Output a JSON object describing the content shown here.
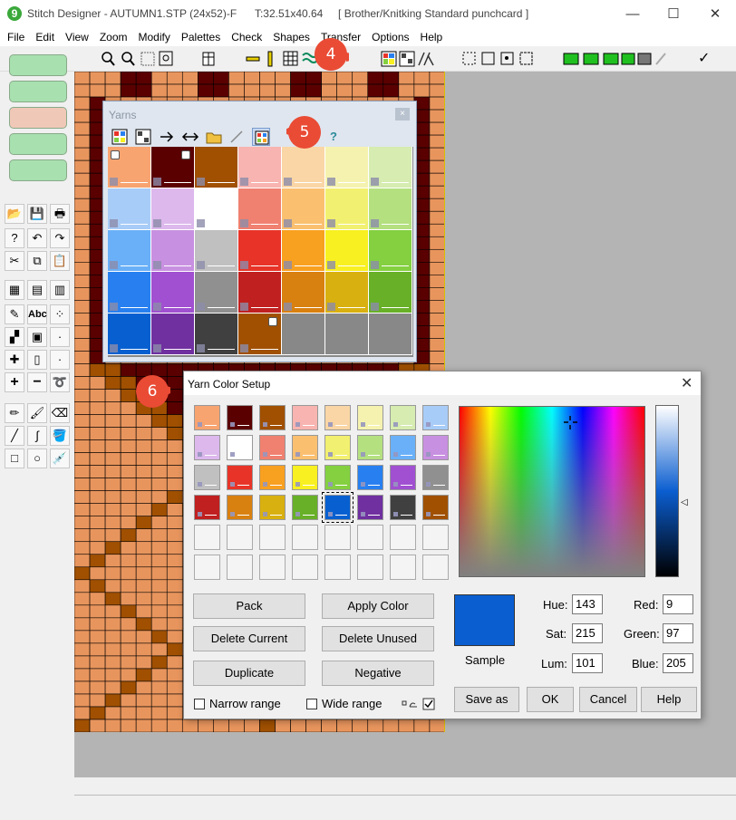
{
  "window": {
    "title": "Stitch Designer - AUTUMN1.STP (24x52)-F      T:32.51x40.64     [ Brother/Knitking Standard punchcard ]",
    "app_icon_glyph": "9",
    "minimize_glyph": "—",
    "maximize_glyph": "☐",
    "close_glyph": "✕"
  },
  "menu": [
    "File",
    "Edit",
    "View",
    "Zoom",
    "Modify",
    "Palettes",
    "Check",
    "Shapes",
    "Transfer",
    "Options",
    "Help"
  ],
  "toolbar": {
    "zoom_icons": [
      "zoom-in-icon",
      "zoom-out-icon",
      "zoom-fit-icon",
      "zoom-window-icon"
    ],
    "right_check_glyph": "✓"
  },
  "tool_panel": {
    "big_buttons": [
      "sweater-icon",
      "chart-icon",
      "stitch-pattern-icon",
      "knitting-machine-icon",
      "image-icon"
    ],
    "abc_label": "Abc",
    "plus_label": "+",
    "minus_label": "−"
  },
  "canvas": {
    "background_color": "#e8955d",
    "dark_color": "#5a0000",
    "brown_color": "#a05000"
  },
  "yarns_palette": {
    "title": "Yarns",
    "close_glyph": "×",
    "help_glyph": "?",
    "rows": [
      [
        "#f8a471",
        "#5a0000",
        "#a05000",
        "#f8b4b0",
        "#fad6a6",
        "#f5f2b0",
        "#d6ecb0"
      ],
      [
        "#a8ccf8",
        "#dcb8ec",
        "#ffffff",
        "#f08070",
        "#fac070",
        "#f2f070",
        "#b4e080"
      ],
      [
        "#6ab0f8",
        "#c890e0",
        "#c0c0c0",
        "#e83428",
        "#f8a020",
        "#f8f020",
        "#84d040"
      ],
      [
        "#2880f0",
        "#a050d0",
        "#909090",
        "#c02020",
        "#d88010",
        "#d8b010",
        "#68b028"
      ],
      [
        "#0860d0",
        "#7030a0",
        "#404040",
        "#a05000",
        "#888888",
        "#888888",
        "#888888"
      ]
    ]
  },
  "dialog": {
    "title": "Yarn Color Setup",
    "close_glyph": "✕",
    "swatches": [
      [
        "#f8a471",
        "#5a0000",
        "#a05000",
        "#f8b4b0",
        "#fad6a6",
        "#f5f2b0",
        "#d6ecb0",
        "#a8ccf8"
      ],
      [
        "#dcb8ec",
        "#ffffff",
        "#f08070",
        "#fac070",
        "#f2f070",
        "#b4e080",
        "#6ab0f8",
        "#c890e0"
      ],
      [
        "#c0c0c0",
        "#e83428",
        "#f8a020",
        "#f8f020",
        "#84d040",
        "#2880f0",
        "#a050d0",
        "#909090"
      ],
      [
        "#c02020",
        "#d88010",
        "#d8b010",
        "#68b028",
        "#0860d0",
        "#7030a0",
        "#404040",
        "#a05000"
      ],
      [
        "",
        "",
        "",
        "",
        "",
        "",
        "",
        ""
      ],
      [
        "",
        "",
        "",
        "",
        "",
        "",
        "",
        ""
      ]
    ],
    "buttons": {
      "pack": "Pack",
      "apply_color": "Apply Color",
      "delete_current": "Delete Current",
      "delete_unused": "Delete Unused",
      "duplicate": "Duplicate",
      "negative": "Negative",
      "save_as": "Save as",
      "ok": "OK",
      "cancel": "Cancel",
      "help": "Help"
    },
    "checkboxes": {
      "narrow_range": "Narrow range",
      "wide_range": "Wide range"
    },
    "sample_label": "Sample",
    "sample_color": "#0b5ed0",
    "fields": {
      "hue_label": "Hue:",
      "hue": "143",
      "sat_label": "Sat:",
      "sat": "215",
      "lum_label": "Lum:",
      "lum": "101",
      "red_label": "Red:",
      "red": "9",
      "green_label": "Green:",
      "green": "97",
      "blue_label": "Blue:",
      "blue": "205"
    }
  },
  "callouts": [
    "4",
    "5",
    "6"
  ],
  "callout_color": "#e94b35"
}
